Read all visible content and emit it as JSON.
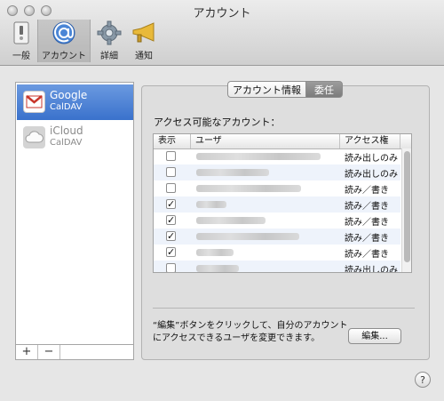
{
  "window": {
    "title": "アカウント"
  },
  "toolbar": {
    "items": [
      {
        "label": "一般",
        "icon": "switch-icon"
      },
      {
        "label": "アカウント",
        "icon": "at-sign-icon",
        "selected": true
      },
      {
        "label": "詳細",
        "icon": "gear-icon"
      },
      {
        "label": "通知",
        "icon": "megaphone-icon"
      }
    ]
  },
  "sidebar": {
    "accounts": [
      {
        "name": "Google",
        "type": "CalDAV",
        "icon": "gmail-icon",
        "selected": true
      },
      {
        "name": "iCloud",
        "type": "CalDAV",
        "icon": "cloud-icon",
        "selected": false
      }
    ],
    "add_label": "+",
    "remove_label": "−"
  },
  "tabs": {
    "left": "アカウント情報",
    "right": "委任"
  },
  "access": {
    "label": "アクセス可能なアカウント：",
    "headers": {
      "show": "表示",
      "user": "ユーザ",
      "permission": "アクセス権"
    },
    "rows": [
      {
        "checked": false,
        "permission": "読み出しのみ"
      },
      {
        "checked": false,
        "permission": "読み出しのみ"
      },
      {
        "checked": false,
        "permission": "読み／書き"
      },
      {
        "checked": true,
        "permission": "読み／書き"
      },
      {
        "checked": true,
        "permission": "読み／書き"
      },
      {
        "checked": true,
        "permission": "読み／書き"
      },
      {
        "checked": true,
        "permission": "読み／書き"
      },
      {
        "checked": false,
        "permission": "読み出しのみ"
      }
    ]
  },
  "footer": {
    "text": "“編集”ボタンをクリックして、自分のアカウントにアクセスできるユーザを変更できます。",
    "edit_label": "編集...",
    "help_label": "?"
  },
  "colors": {
    "selection": "#3a72cc",
    "accent": "#4b86d6"
  }
}
